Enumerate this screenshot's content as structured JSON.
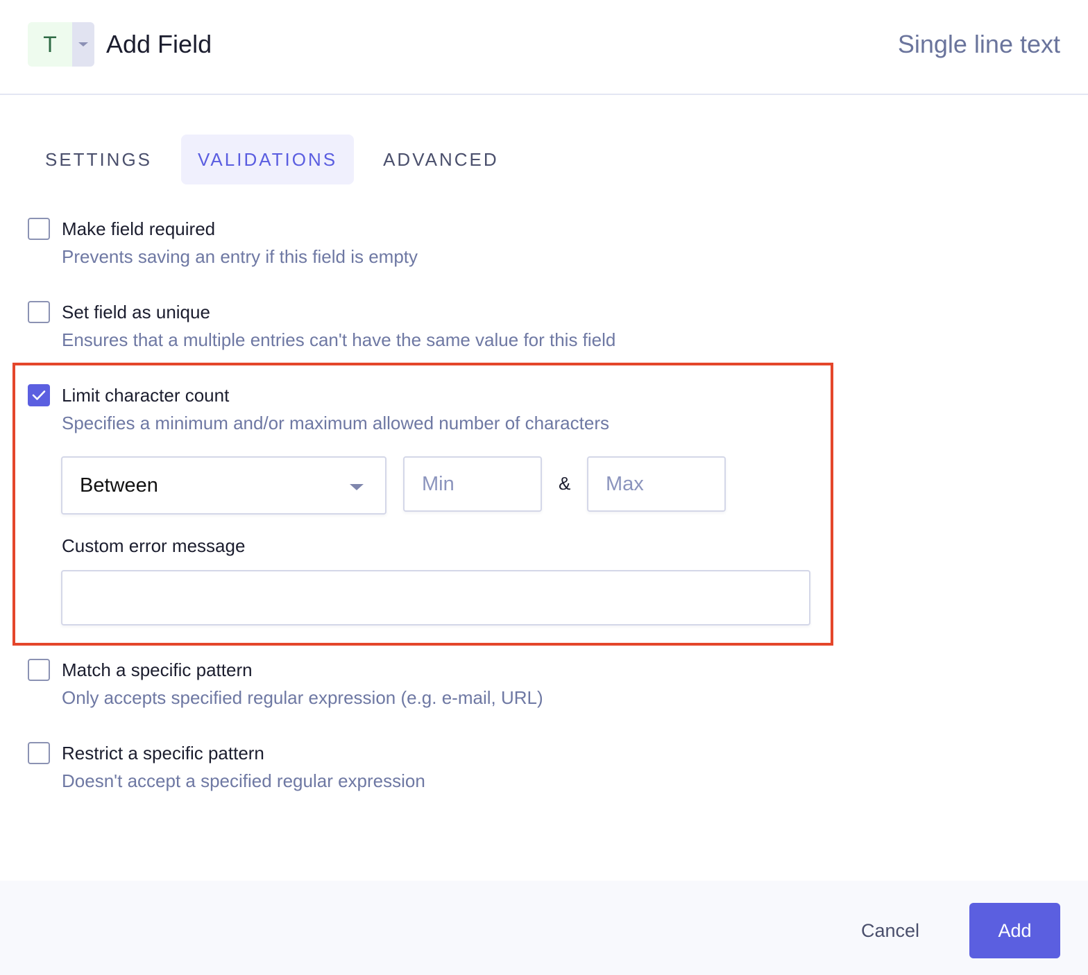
{
  "header": {
    "type_icon_letter": "T",
    "title": "Add Field",
    "field_type": "Single line text"
  },
  "tabs": [
    {
      "label": "SETTINGS",
      "active": false
    },
    {
      "label": "VALIDATIONS",
      "active": true
    },
    {
      "label": "ADVANCED",
      "active": false
    }
  ],
  "validations": [
    {
      "label": "Make field required",
      "description": "Prevents saving an entry if this field is empty",
      "checked": false
    },
    {
      "label": "Set field as unique",
      "description": "Ensures that a multiple entries can't have the same value for this field",
      "checked": false
    },
    {
      "label": "Limit character count",
      "description": "Specifies a minimum and/or maximum allowed number of characters",
      "checked": true
    },
    {
      "label": "Match a specific pattern",
      "description": "Only accepts specified regular expression (e.g. e-mail, URL)",
      "checked": false
    },
    {
      "label": "Restrict a specific pattern",
      "description": "Doesn't accept a specified regular expression",
      "checked": false
    }
  ],
  "char_limit": {
    "mode_selected": "Between",
    "min_value": "",
    "min_placeholder": "Min",
    "separator": "&",
    "max_value": "",
    "max_placeholder": "Max",
    "custom_error_label": "Custom error message",
    "custom_error_value": ""
  },
  "footer": {
    "cancel_label": "Cancel",
    "add_label": "Add"
  },
  "colors": {
    "accent": "#5b5fe0",
    "highlight_border": "#e4462b"
  }
}
